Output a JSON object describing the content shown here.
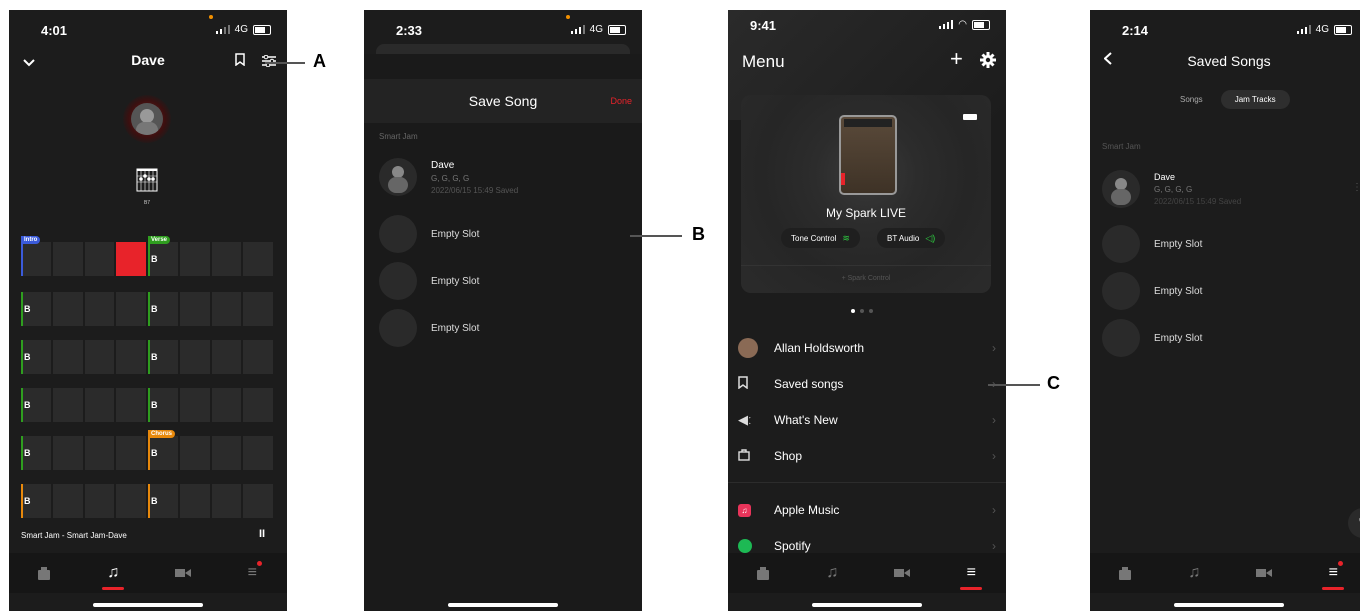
{
  "callouts": {
    "a": "A",
    "b": "B",
    "c": "C"
  },
  "phone1": {
    "time": "4:01",
    "network": "4G",
    "title": "Dave",
    "chord_name": "B7",
    "sections": {
      "intro": "Intro",
      "verse": "Verse",
      "chorus": "Chorus"
    },
    "chord": "B",
    "now_playing": "Smart Jam - Smart Jam-Dave",
    "pause_icon": "II"
  },
  "phone2": {
    "time": "2:33",
    "network": "4G",
    "title": "Save Song",
    "done": "Done",
    "section": "Smart Jam",
    "song": {
      "name": "Dave",
      "chords": "G, G, G, G",
      "saved": "2022/06/15 15:49 Saved"
    },
    "slots": [
      "Empty Slot",
      "Empty Slot",
      "Empty Slot"
    ]
  },
  "phone3": {
    "time": "9:41",
    "title": "Menu",
    "device_name": "My Spark LIVE",
    "tone_control": "Tone Control",
    "bt_audio": "BT Audio",
    "spark_control": "+ Spark Control",
    "items": [
      {
        "label": "Allan Holdsworth",
        "icon": "user-avatar"
      },
      {
        "label": "Saved songs",
        "icon": "bookmark-icon"
      },
      {
        "label": "What's New",
        "icon": "megaphone-icon"
      },
      {
        "label": "Shop",
        "icon": "shopping-bag-icon"
      },
      {
        "label": "Apple Music",
        "icon": "apple-music-icon"
      },
      {
        "label": "Spotify",
        "icon": "spotify-icon"
      }
    ],
    "accent": "#e8232a"
  },
  "phone4": {
    "time": "2:14",
    "network": "4G",
    "title": "Saved Songs",
    "seg_songs": "Songs",
    "seg_jam": "Jam Tracks",
    "section": "Smart Jam",
    "song": {
      "name": "Dave",
      "chords": "G, G, G, G",
      "saved": "2022/06/15 15:49 Saved"
    },
    "slots": [
      "Empty Slot",
      "Empty Slot",
      "Empty Slot"
    ]
  }
}
